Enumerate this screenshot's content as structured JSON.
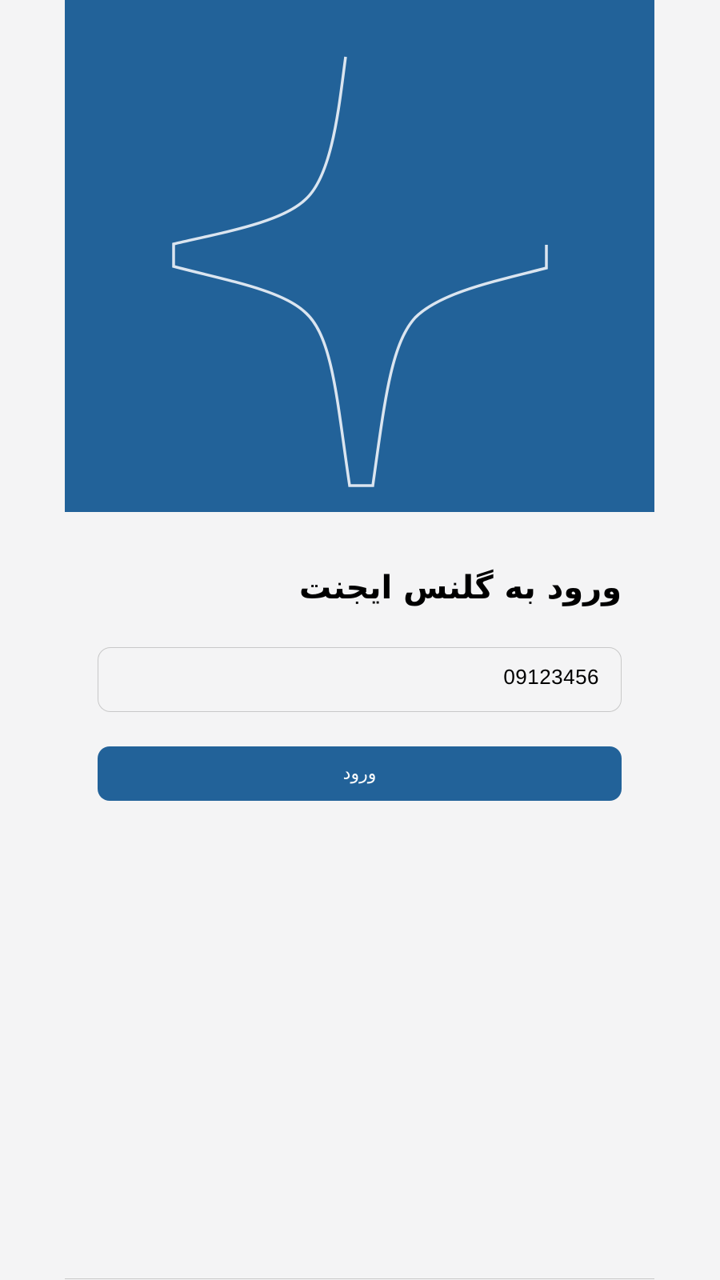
{
  "login": {
    "title": "ورود به گلنس ایجنت",
    "phone_value": "09123456",
    "submit_label": "ورود"
  },
  "theme": {
    "brand_color": "#226299",
    "background_color": "#f4f4f5",
    "logo_stroke_color": "#dbe5f0"
  },
  "hero": {
    "logo_icon": "sparkle-star-outline-icon"
  }
}
